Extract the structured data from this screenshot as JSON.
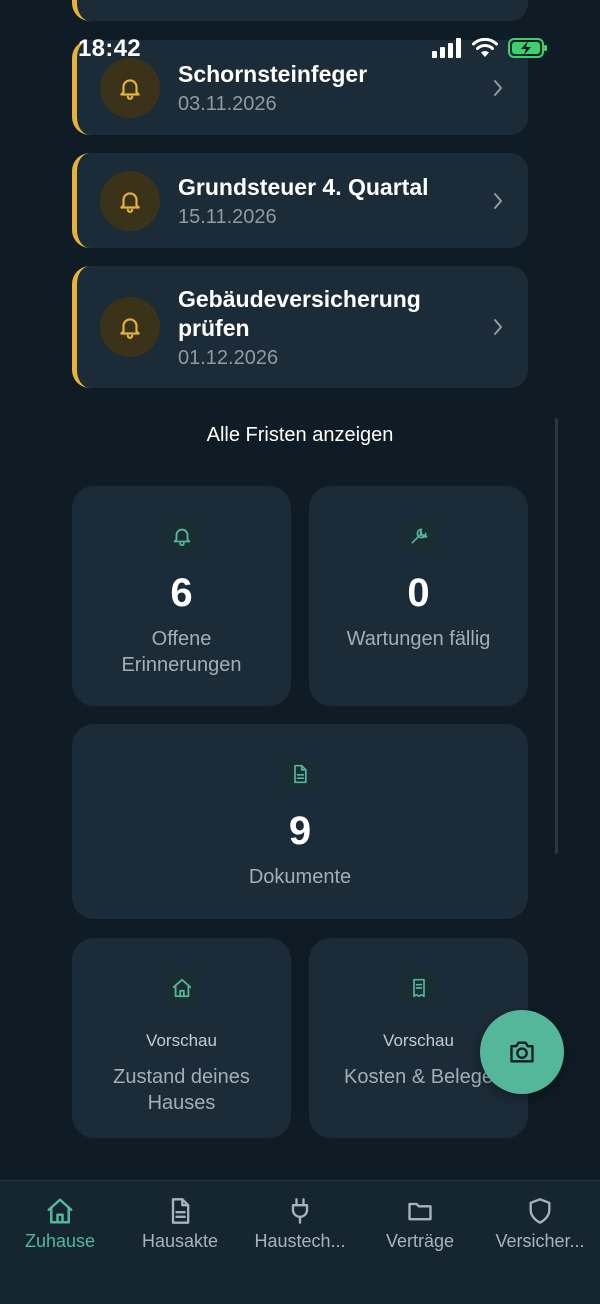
{
  "status_bar": {
    "time": "18:42"
  },
  "reminders": [
    {
      "title": "Schornsteinfeger",
      "date": "03.11.2026"
    },
    {
      "title": "Grundsteuer 4. Quartal",
      "date": "15.11.2026"
    },
    {
      "title_line1": "Gebäudeversicherung",
      "title_line2": "prüfen",
      "date": "01.12.2026"
    }
  ],
  "all_deadlines_label": "Alle Fristen anzeigen",
  "stats": {
    "open_reminders": {
      "value": "6",
      "label_line1": "Offene",
      "label_line2": "Erinnerungen"
    },
    "maintenance_due": {
      "value": "0",
      "label": "Wartungen fällig"
    },
    "documents": {
      "value": "9",
      "label": "Dokumente"
    }
  },
  "previews": {
    "house_condition": {
      "badge": "Vorschau",
      "label_line1": "Zustand deines",
      "label_line2": "Hauses"
    },
    "costs": {
      "badge": "Vorschau",
      "label": "Kosten & Belege"
    }
  },
  "tabs": [
    {
      "label": "Zuhause",
      "icon": "home-icon",
      "active": true
    },
    {
      "label": "Hausakte",
      "icon": "document-icon"
    },
    {
      "label": "Haustech...",
      "icon": "plug-icon"
    },
    {
      "label": "Verträge",
      "icon": "folder-icon"
    },
    {
      "label": "Versicher...",
      "icon": "shield-icon"
    }
  ],
  "colors": {
    "background": "#0f1c25",
    "card": "#1c2b38",
    "accent_yellow": "#e6b23c",
    "accent_green": "#55b79a"
  }
}
